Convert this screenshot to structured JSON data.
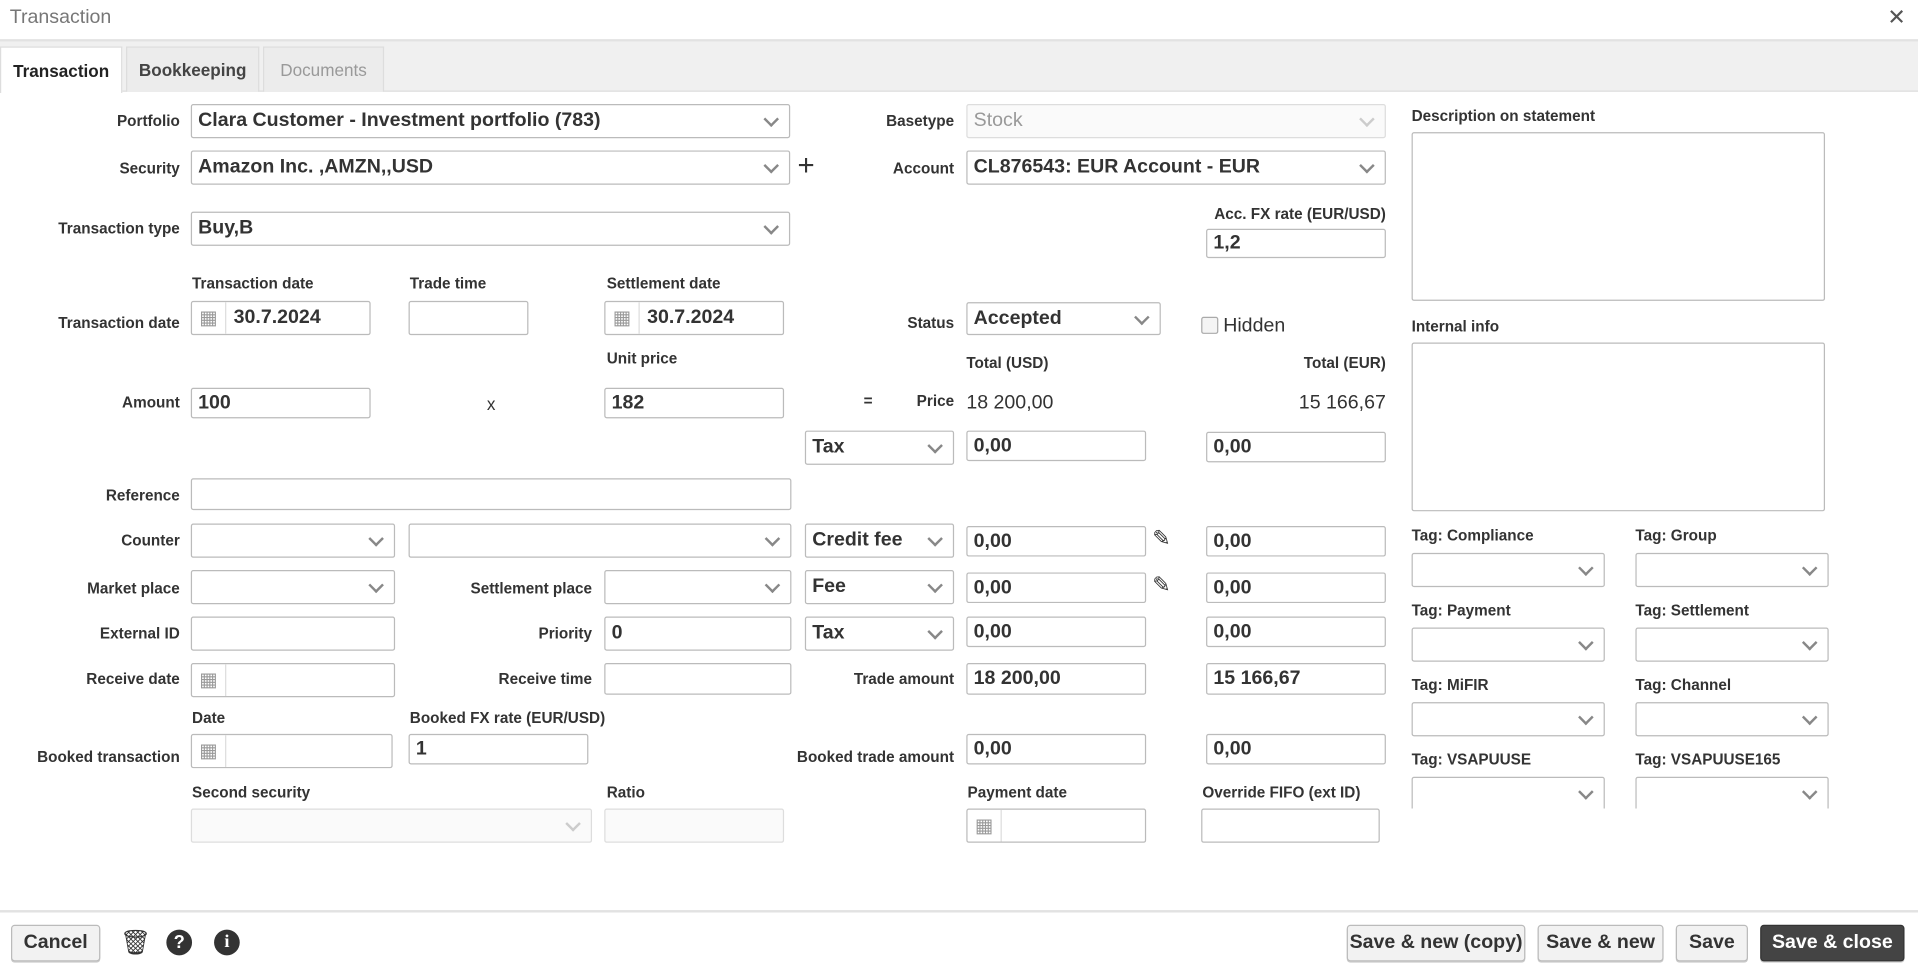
{
  "window": {
    "title": "Transaction",
    "close_icon": "close-icon"
  },
  "tabs": [
    {
      "label": "Transaction",
      "active": true
    },
    {
      "label": "Bookkeeping"
    },
    {
      "label": "Documents",
      "disabled": true
    }
  ],
  "form": {
    "portfolio": {
      "label": "Portfolio",
      "value": "Clara Customer - Investment portfolio (783)"
    },
    "security": {
      "label": "Security",
      "value": "Amazon Inc. ,AMZN,,USD",
      "add": "+"
    },
    "transaction_type": {
      "label": "Transaction type",
      "value": "Buy,B"
    },
    "basetype": {
      "label": "Basetype",
      "value": "Stock"
    },
    "account": {
      "label": "Account",
      "value": "CL876543: EUR Account - EUR"
    },
    "acc_fx": {
      "label": "Acc. FX rate (EUR/USD)",
      "value": "1,2"
    },
    "transaction_date_row": {
      "label": "Transaction date",
      "col_transaction_date": "Transaction date",
      "col_trade_time": "Trade time",
      "col_settlement_date": "Settlement date",
      "transaction_date": "30.7.2024",
      "trade_time": "",
      "settlement_date": "30.7.2024"
    },
    "status": {
      "label": "Status",
      "value": "Accepted"
    },
    "hidden": {
      "label": "Hidden",
      "checked": false
    },
    "amount": {
      "label": "Amount",
      "value": "100",
      "times": "x",
      "unit_price_label": "Unit price",
      "unit_price": "182",
      "equals": "="
    },
    "totals": {
      "usd_label": "Total (USD)",
      "eur_label": "Total (EUR)",
      "price_label": "Price",
      "price_usd": "18 200,00",
      "price_eur": "15 166,67"
    },
    "cost_rows": [
      {
        "type": "Tax",
        "usd": "0,00",
        "eur": "0,00"
      },
      {
        "type": "Credit fee",
        "usd": "0,00",
        "eur": "0,00"
      },
      {
        "type": "Fee",
        "usd": "0,00",
        "eur": "0,00"
      },
      {
        "type": "Tax",
        "usd": "0,00",
        "eur": "0,00"
      }
    ],
    "reference": {
      "label": "Reference",
      "value": ""
    },
    "counter": {
      "label": "Counter",
      "value1": "",
      "value2": ""
    },
    "market_place": {
      "label": "Market place",
      "value": ""
    },
    "settlement_place": {
      "label": "Settlement place",
      "value": ""
    },
    "external_id": {
      "label": "External ID",
      "value": ""
    },
    "priority": {
      "label": "Priority",
      "value": "0"
    },
    "receive_date": {
      "label": "Receive date",
      "value": ""
    },
    "receive_time": {
      "label": "Receive time",
      "value": ""
    },
    "trade_amount": {
      "label": "Trade amount",
      "usd": "18 200,00",
      "eur": "15 166,67"
    },
    "booked": {
      "label": "Booked transaction",
      "date_label": "Date",
      "date": "",
      "fx_label": "Booked FX rate (EUR/USD)",
      "fx": "1",
      "trade_label": "Booked trade amount",
      "usd": "0,00",
      "eur": "0,00"
    },
    "second_security": {
      "label": "Second security",
      "value": ""
    },
    "ratio": {
      "label": "Ratio",
      "value": ""
    },
    "payment_date": {
      "label": "Payment date",
      "value": ""
    },
    "override_fifo": {
      "label": "Override FIFO (ext ID)",
      "value": ""
    },
    "description": {
      "label": "Description on statement",
      "value": ""
    },
    "internal_info": {
      "label": "Internal info",
      "value": ""
    },
    "tags": [
      {
        "label": "Tag: Compliance"
      },
      {
        "label": "Tag: Group"
      },
      {
        "label": "Tag: Payment"
      },
      {
        "label": "Tag: Settlement"
      },
      {
        "label": "Tag: MiFIR"
      },
      {
        "label": "Tag: Channel"
      },
      {
        "label": "Tag: VSAPUUSE"
      },
      {
        "label": "Tag: VSAPUUSE165"
      }
    ]
  },
  "footer": {
    "cancel": "Cancel",
    "save_new_copy": "Save & new (copy)",
    "save_new": "Save & new",
    "save": "Save",
    "save_close": "Save & close",
    "icons": [
      "trash-icon",
      "help-icon",
      "info-icon"
    ]
  }
}
